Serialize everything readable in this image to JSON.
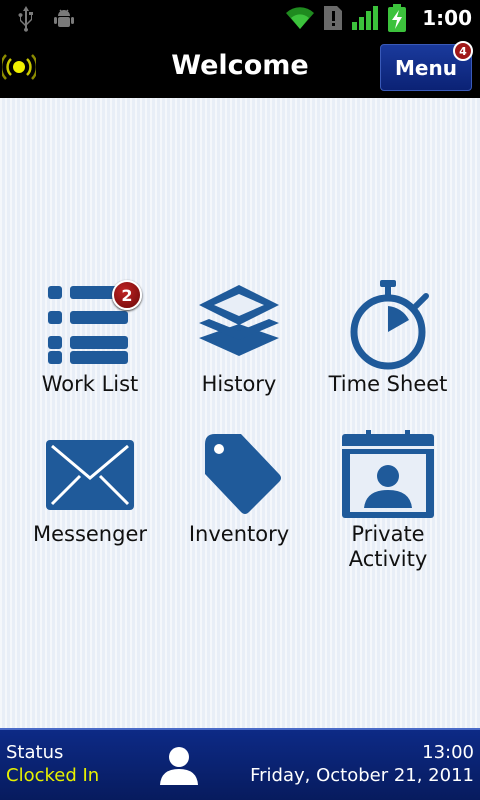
{
  "status_bar": {
    "time": "1:00",
    "icons": [
      "usb-icon",
      "android-debug-icon",
      "wifi-icon",
      "sim-alert-icon",
      "cell-signal-icon",
      "battery-charging-icon"
    ]
  },
  "header": {
    "title": "Welcome",
    "menu_label": "Menu",
    "menu_badge": "4"
  },
  "tiles": [
    {
      "label": "Work List",
      "badge": "2",
      "icon": "list-icon"
    },
    {
      "label": "History",
      "icon": "layers-icon"
    },
    {
      "label": "Time Sheet",
      "icon": "stopwatch-icon"
    },
    {
      "label": "Messenger",
      "icon": "envelope-icon"
    },
    {
      "label": "Inventory",
      "icon": "tag-icon"
    },
    {
      "label": "Private\nActivity",
      "icon": "calendar-person-icon"
    }
  ],
  "footer": {
    "status_label": "Status",
    "status_value": "Clocked In",
    "time": "13:00",
    "date": "Friday, October 21, 2011"
  },
  "colors": {
    "icon_blue": "#1f5a9a",
    "status_value": "#e6f000",
    "footer_bg": "#0d2a86",
    "badge_red": "#a01818"
  }
}
